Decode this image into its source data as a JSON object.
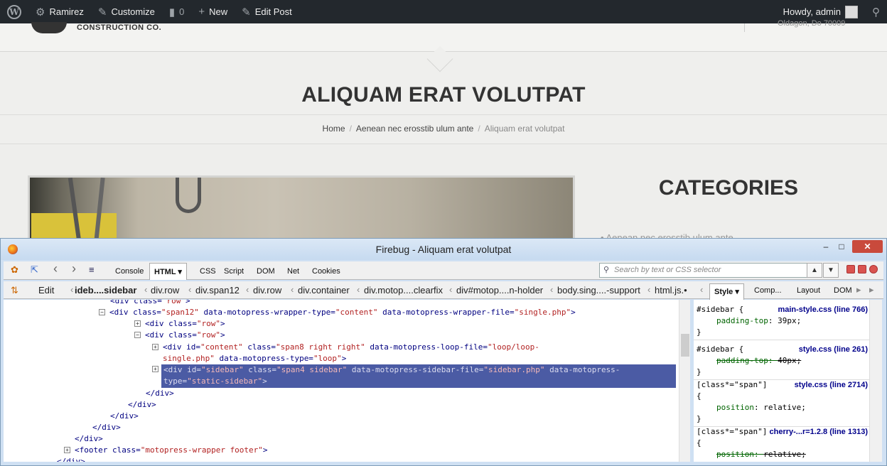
{
  "admin_bar": {
    "site_name": "Ramirez",
    "customize": "Customize",
    "comments_count": "0",
    "new": "New",
    "edit_post": "Edit Post",
    "howdy": "Howdy, admin"
  },
  "site_header": {
    "logo_text": "CONSTRUCTION CO.",
    "address_partial": "Oldagon, Do 70009"
  },
  "title_band": {
    "page_title": "ALIQUAM ERAT VOLUTPAT",
    "breadcrumb": {
      "home": "Home",
      "sep": "/",
      "category": "Aenean nec erosstib ulum ante",
      "current": "Aliquam erat volutpat"
    }
  },
  "sidebar": {
    "categories_title": "CATEGORIES",
    "first_item": "Aenean nec erosstib ulum ante"
  },
  "firebug": {
    "window_title": "Firebug - Aliquam erat volutpat",
    "win_min": "–",
    "win_max": "□",
    "win_close": "✕",
    "tabs": [
      "Console",
      "HTML",
      "CSS",
      "Script",
      "DOM",
      "Net",
      "Cookies"
    ],
    "active_tab": "HTML",
    "search_placeholder": "Search by text or CSS selector",
    "edit_label": "Edit",
    "breadcrumbs": [
      "ideb....sidebar",
      "div.row",
      "div.span12",
      "div.row",
      "div.container",
      "div.motop....clearfix",
      "div#motop....n-holder",
      "body.sing....-support",
      "html.js.•"
    ],
    "side_tabs": [
      "Style",
      "Comp...",
      "Layout",
      "DOM"
    ],
    "active_side_tab": "Style",
    "html_lines": {
      "l1": {
        "tag_open": "<div ",
        "attr": "class=",
        "val": "\"row\"",
        "end": ">"
      },
      "l2": {
        "toggle": "−",
        "tag_open": "<div ",
        "a1": "class=",
        "v1": "\"span12\"",
        "a2": " data-motopress-wrapper-type=",
        "v2": "\"content\"",
        "a3": " data-motopress-wrapper-file=",
        "v3": "\"single.php\"",
        "end": ">"
      },
      "l3": {
        "toggle": "+",
        "tag_open": "<div ",
        "attr": "class=",
        "val": "\"row\"",
        "end": ">"
      },
      "l4": {
        "toggle": "−",
        "tag_open": "<div ",
        "attr": "class=",
        "val": "\"row\"",
        "end": ">"
      },
      "l5": {
        "toggle": "+",
        "tag_open": "<div ",
        "a1": "id=",
        "v1": "\"content\"",
        "a2": " class=",
        "v2": "\"span8 right right\"",
        "a3": " data-motopress-loop-file=",
        "v3": "\"loop/loop-"
      },
      "l6": {
        "v1": "single.php\"",
        "a1": " data-motopress-type=",
        "v2": "\"loop\"",
        "end": ">"
      },
      "l7": {
        "toggle": "+",
        "tag_open": "<div ",
        "a1": "id=",
        "v1": "\"sidebar\"",
        "a2": " class=",
        "v2": "\"span4 sidebar\"",
        "a3": " data-motopress-sidebar-file=",
        "v3": "\"sidebar.php\"",
        "a4": " data-motopress-"
      },
      "l8": {
        "a1": "type=",
        "v1": "\"static-sidebar\"",
        "end": ">"
      },
      "l9": "</div>",
      "l10": "</div>",
      "l11": "</div>",
      "l12": "</div>",
      "l13": "</div>",
      "l14": {
        "toggle": "+",
        "tag_open": "<footer ",
        "attr": "class=",
        "val": "\"motopress-wrapper footer\"",
        "end": ">"
      },
      "l15": "</div>"
    },
    "style_rules": [
      {
        "selector": "#sidebar {",
        "source": "main-style.css (line 766)",
        "prop": "padding-top",
        "value": "39px;",
        "overridden": false
      },
      {
        "selector": "#sidebar {",
        "source": "style.css (line 261)",
        "prop": "padding-top",
        "value": "40px;",
        "overridden": true
      },
      {
        "selector": "[class*=\"span\"]",
        "source": "style.css (line 2714)",
        "prop": "position",
        "value": "relative;",
        "overridden": false
      },
      {
        "selector": "[class*=\"span\"]",
        "source": "cherry-...r=1.2.8 (line 1313)",
        "prop": "position",
        "value": "relative;",
        "overridden": true
      }
    ],
    "brace_open": "{",
    "brace_close": "}"
  }
}
